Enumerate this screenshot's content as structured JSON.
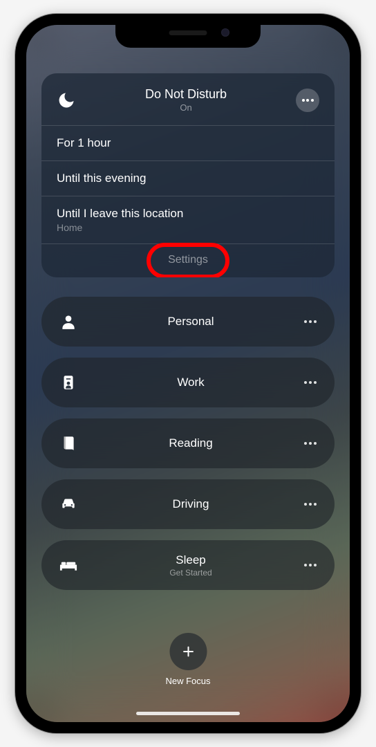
{
  "dnd": {
    "title": "Do Not Disturb",
    "status": "On",
    "options": [
      {
        "label": "For 1 hour",
        "sub": ""
      },
      {
        "label": "Until this evening",
        "sub": ""
      },
      {
        "label": "Until I leave this location",
        "sub": "Home"
      }
    ],
    "settings_label": "Settings"
  },
  "focus_modes": [
    {
      "name": "Personal",
      "sub": "",
      "icon": "person"
    },
    {
      "name": "Work",
      "sub": "",
      "icon": "badge"
    },
    {
      "name": "Reading",
      "sub": "",
      "icon": "book"
    },
    {
      "name": "Driving",
      "sub": "",
      "icon": "car"
    },
    {
      "name": "Sleep",
      "sub": "Get Started",
      "icon": "bed"
    }
  ],
  "new_focus_label": "New Focus",
  "annotations": {
    "highlight": "settings-button"
  }
}
